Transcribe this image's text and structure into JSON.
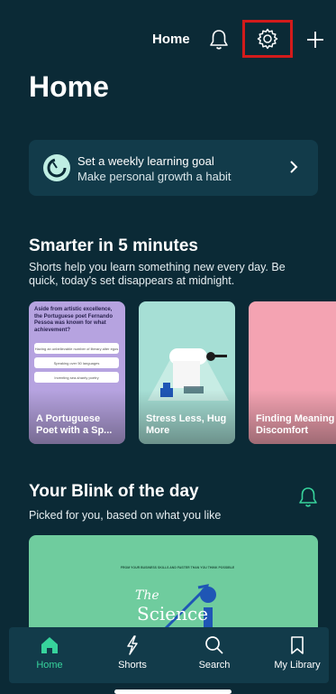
{
  "topbar": {
    "title": "Home",
    "icons": [
      "bell-icon",
      "gear-icon",
      "plus-icon"
    ]
  },
  "page": {
    "title": "Home"
  },
  "goal_card": {
    "line1": "Set a weekly learning goal",
    "line2": "Make personal growth a habit",
    "icon": "goal-progress-icon"
  },
  "smarter": {
    "title": "Smarter in 5 minutes",
    "subtitle": "Shorts help you learn something new every day. Be quick, today's set disappears at midnight.",
    "cards": [
      {
        "label": "A Portuguese Poet with a Sp...",
        "quiz_question": "Aside from artistic excellence, the Portuguese poet Fernando Pessoa was known for what achievement?",
        "options": [
          "Having an unbelievable number of literary alter egos",
          "Speaking over 50 languages",
          "Inventing sea-shanty poetry"
        ]
      },
      {
        "label": "Stress Less, Hug More"
      },
      {
        "label": "Finding Meaning in Discomfort"
      }
    ]
  },
  "blink": {
    "title": "Your Blink of the day",
    "subtitle": "Picked for you, based on what you like",
    "book": {
      "tagline": "FROM YOUR BUSINESS SKILLS AND FASTER THAN YOU THINK POSSIBLE",
      "title_line1": "The",
      "title_line2": "Science"
    }
  },
  "bottom_nav": {
    "items": [
      {
        "label": "Home",
        "icon": "home-icon",
        "active": true
      },
      {
        "label": "Shorts",
        "icon": "lightning-icon",
        "active": false
      },
      {
        "label": "Search",
        "icon": "search-icon",
        "active": false
      },
      {
        "label": "My Library",
        "icon": "bookmark-icon",
        "active": false
      }
    ]
  },
  "colors": {
    "background": "#0b2a36",
    "card_background": "#123b4a",
    "accent_green": "#37d39c",
    "highlight_red": "#d31b1b",
    "card_purple": "#b6a3e0",
    "card_teal": "#a6dfd5",
    "card_pink": "#f4a3b2",
    "book_green": "#6fcc9e"
  }
}
